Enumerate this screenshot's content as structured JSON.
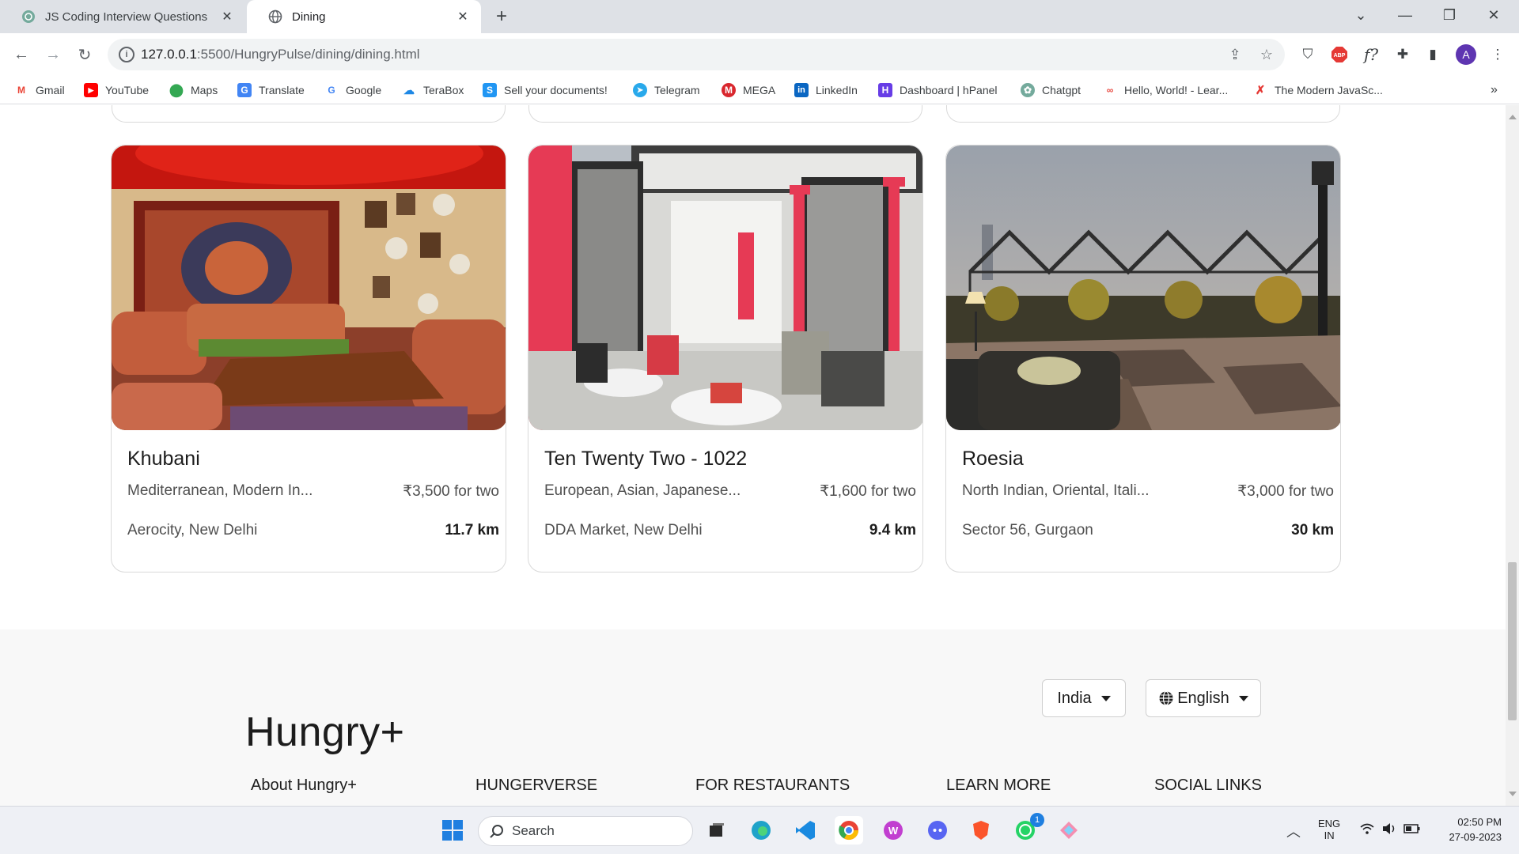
{
  "browser": {
    "tabs": [
      {
        "title": "JS Coding Interview Questions",
        "active": false
      },
      {
        "title": "Dining",
        "active": true
      }
    ],
    "url_host": "127.0.0.1",
    "url_path": ":5500/HungryPulse/dining/dining.html",
    "bookmarks": [
      "Gmail",
      "YouTube",
      "Maps",
      "Translate",
      "Google",
      "TeraBox",
      "Sell your documents!",
      "Telegram",
      "MEGA",
      "LinkedIn",
      "Dashboard | hPanel",
      "Chatgpt",
      "Hello, World! - Lear...",
      "The Modern JavaSc..."
    ],
    "avatar_letter": "A"
  },
  "restaurants": [
    {
      "name": "Khubani",
      "cuisine": "Mediterranean, Modern In...",
      "price": "₹3,500 for two",
      "location": "Aerocity, New Delhi",
      "distance": "11.7 km"
    },
    {
      "name": "Ten Twenty Two - 1022",
      "cuisine": "European, Asian, Japanese...",
      "price": "₹1,600 for two",
      "location": "DDA Market, New Delhi",
      "distance": "9.4 km"
    },
    {
      "name": "Roesia",
      "cuisine": "North Indian, Oriental, Itali...",
      "price": "₹3,000 for two",
      "location": "Sector 56, Gurgaon",
      "distance": "30 km"
    }
  ],
  "footer": {
    "brand": "Hungry+",
    "country": "India",
    "language": "English",
    "columns": [
      "About Hungry+",
      "HUNGERVERSE",
      "FOR RESTAURANTS",
      "LEARN MORE",
      "SOCIAL LINKS"
    ]
  },
  "taskbar": {
    "search_placeholder": "Search",
    "whatsapp_badge": "1",
    "lang_top": "ENG",
    "lang_bottom": "IN",
    "time": "02:50 PM",
    "date": "27-09-2023"
  },
  "colors": {
    "accent_avatar": "#5e35b1",
    "page_bg_footer": "#f8f8f8"
  }
}
